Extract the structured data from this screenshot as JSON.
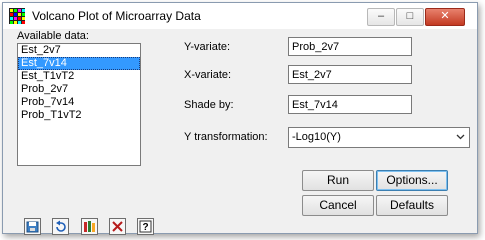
{
  "window": {
    "title": "Volcano Plot of Microarray Data",
    "controls": {
      "minimize": "–",
      "maximize": "□",
      "close": "✕"
    }
  },
  "available_data": {
    "label": "Available data:",
    "items": [
      "Est_2v7",
      "Est_7v14",
      "Est_T1vT2",
      "Prob_2v7",
      "Prob_7v14",
      "Prob_T1vT2"
    ],
    "selected": "Est_7v14"
  },
  "fields": {
    "y_variate": {
      "label": "Y-variate:",
      "value": "Prob_2v7"
    },
    "x_variate": {
      "label": "X-variate:",
      "value": "Est_2v7"
    },
    "shade_by": {
      "label": "Shade by:",
      "value": "Est_7v14"
    },
    "y_transformation": {
      "label": "Y transformation:",
      "value": "-Log10(Y)"
    }
  },
  "buttons": {
    "run": "Run",
    "options": "Options...",
    "cancel": "Cancel",
    "defaults": "Defaults"
  },
  "toolbar": [
    "save-icon",
    "undo-icon",
    "spreadsheet-icon",
    "clear-icon",
    "help-icon"
  ]
}
